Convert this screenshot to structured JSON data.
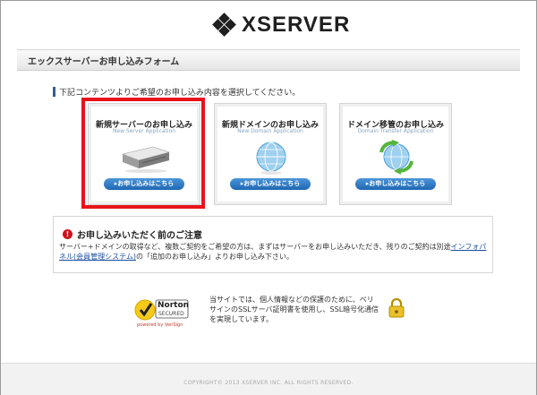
{
  "header": {
    "logo_text": "XSERVER"
  },
  "titlebar": {
    "title": "エックスサーバーお申し込みフォーム"
  },
  "instruction": "下記コンテンツよりご希望のお申し込み内容を選択してください。",
  "cards": [
    {
      "title": "新規サーバーのお申し込み",
      "subtitle": "New Server Application",
      "button": "▸お申し込みはこちら",
      "icon": "server-icon",
      "selected": true
    },
    {
      "title": "新規ドメインのお申し込み",
      "subtitle": "New Domain Application",
      "button": "▸お申し込みはこちら",
      "icon": "globe-icon",
      "selected": false
    },
    {
      "title": "ドメイン移管のお申し込み",
      "subtitle": "Domain Transfer Application",
      "button": "▸お申し込みはこちら",
      "icon": "globe-transfer-icon",
      "selected": false
    }
  ],
  "notice": {
    "title": "お申し込みいただく前のご注意",
    "body_before": "サーバー+ドメインの取得など、複数ご契約をご希望の方は、まずはサーバーをお申し込みいただき、残りのご契約は別途",
    "link": "インフォパネル(会員管理システム)",
    "body_after": "の「追加のお申し込み」よりお申し込み下さい。"
  },
  "norton": {
    "top": "Norton",
    "sub": "SECURED",
    "powered": "powered by VeriSign"
  },
  "ssl_text": "当サイトでは、個人情報などの保護のために、ベリサインのSSLサーバ証明書を使用し、SSL暗号化通信を実現しています。",
  "footer": {
    "copyright": "COPYRIGHT© 2013 XSERVER INC. ALL RIGHTS RESERVED."
  },
  "colors": {
    "accent_red": "#e8131a",
    "button_blue": "#1f67b4",
    "link_blue": "#1a4fa0"
  }
}
